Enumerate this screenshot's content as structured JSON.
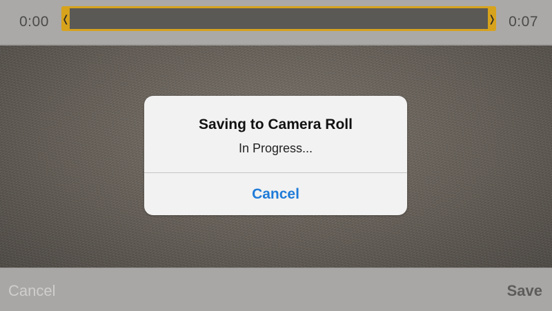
{
  "trim_bar": {
    "start_time": "0:00",
    "end_time": "0:07",
    "left_handle_glyph": "❬",
    "right_handle_glyph": "❭",
    "accent_color": "#d6a21e"
  },
  "alert": {
    "title": "Saving to Camera Roll",
    "message": "In Progress...",
    "button_label": "Cancel",
    "button_color": "#1f7bd8"
  },
  "toolbar": {
    "cancel_label": "Cancel",
    "save_label": "Save"
  }
}
